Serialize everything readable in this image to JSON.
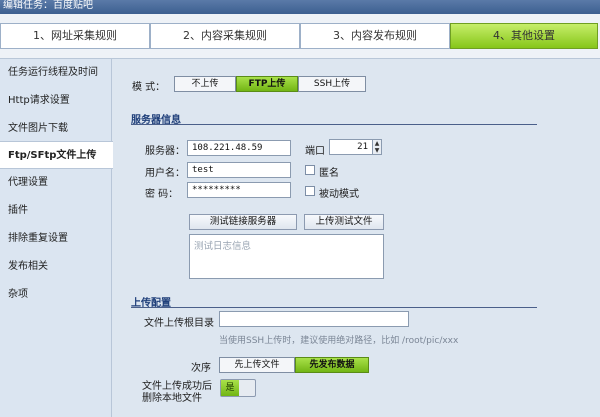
{
  "window": {
    "title": "编辑任务：百度贴吧"
  },
  "steps": [
    {
      "label": "1、网址采集规则"
    },
    {
      "label": "2、内容采集规则"
    },
    {
      "label": "3、内容发布规则"
    },
    {
      "label": "4、其他设置"
    }
  ],
  "sidebar": {
    "items": [
      {
        "label": "任务运行线程及时间"
      },
      {
        "label": "Http请求设置"
      },
      {
        "label": "文件图片下载"
      },
      {
        "label": "Ftp/SFtp文件上传"
      },
      {
        "label": "代理设置"
      },
      {
        "label": "插件"
      },
      {
        "label": "排除重复设置"
      },
      {
        "label": "发布相关"
      },
      {
        "label": "杂项"
      }
    ]
  },
  "mode": {
    "label": "模 式：",
    "options": [
      "不上传",
      "FTP上传",
      "SSH上传"
    ],
    "selected": "FTP上传"
  },
  "server": {
    "section_title": "服务器信息",
    "host_label": "服务器：",
    "host_value": "108.221.48.59",
    "port_label": "端口",
    "port_value": "21",
    "user_label": "用户名：",
    "user_value": "test",
    "anonymous_label": "匿名",
    "password_label": "密 码：",
    "password_value": "*********",
    "passive_label": "被动模式",
    "test_connect_button": "测试链接服务器",
    "upload_test_button": "上传测试文件",
    "log_placeholder": "测试日志信息"
  },
  "upload": {
    "section_title": "上传配置",
    "root_label": "文件上传根目录",
    "root_value": "",
    "root_hint": "当使用SSH上传时，建议使用绝对路径，比如  /root/pic/xxx",
    "order_label": "次序",
    "order_options": [
      "先上传文件",
      "先发布数据"
    ],
    "order_selected": "先发布数据",
    "delete_label_line1": "文件上传成功后",
    "delete_label_line2": "删除本地文件",
    "delete_toggle": "是"
  },
  "colors": {
    "accent_green": "#86c619",
    "section_blue": "#1f3f7a",
    "panel_bg": "#dde6f0"
  }
}
